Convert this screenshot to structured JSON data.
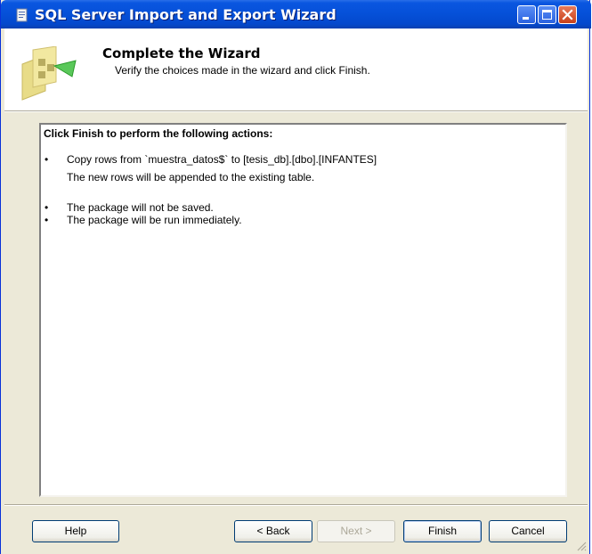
{
  "window": {
    "title": "SQL Server Import and Export Wizard",
    "controls": {
      "minimize": "minimize-icon",
      "maximize": "maximize-icon",
      "close": "close-icon"
    }
  },
  "header": {
    "title": "Complete the Wizard",
    "subtitle": "Verify the choices made in the wizard and click Finish."
  },
  "summary": {
    "heading": "Click Finish to perform the following actions:",
    "items": [
      {
        "text": "Copy rows from `muestra_datos$` to [tesis_db].[dbo].[INFANTES]",
        "detail": "The new rows will be appended to the existing table."
      },
      {
        "text": "The package will not be saved."
      },
      {
        "text": "The package will be run immediately."
      }
    ]
  },
  "buttons": {
    "help": "Help",
    "back": "< Back",
    "next": "Next >",
    "finish": "Finish",
    "cancel": "Cancel"
  },
  "colors": {
    "titlebar": "#0550d8",
    "dialog_bg": "#ece9d8",
    "close_button": "#c8401a"
  }
}
